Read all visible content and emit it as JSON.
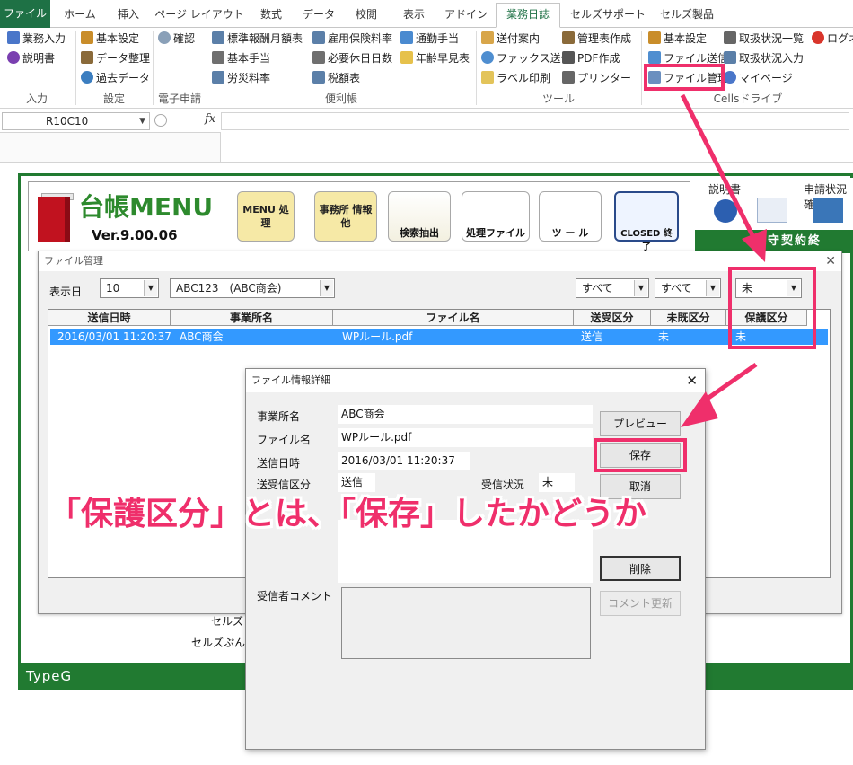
{
  "ribbon": {
    "tabs": [
      "ファイル",
      "ホーム",
      "挿入",
      "ページ レイアウト",
      "数式",
      "データ",
      "校閲",
      "表示",
      "アドイン",
      "業務日誌",
      "セルズサポート",
      "セルズ製品"
    ],
    "active_tab": "業務日誌",
    "groups": {
      "input": {
        "label": "入力",
        "items": [
          "業務入力",
          "説明書"
        ]
      },
      "settings": {
        "label": "設定",
        "items": [
          "基本設定",
          "データ整理",
          "過去データ"
        ]
      },
      "e_apply": {
        "label": "電子申請",
        "items": [
          "確認"
        ]
      },
      "handy": {
        "label": "便利帳",
        "items": [
          "標準報酬月額表",
          "基本手当",
          "労災料率",
          "雇用保険料率",
          "必要休日日数",
          "税額表",
          "通勤手当",
          "年齢早見表"
        ]
      },
      "tools": {
        "label": "ツール",
        "items": [
          "送付案内",
          "ファックス送信",
          "ラベル印刷",
          "管理表作成",
          "PDF作成",
          "プリンター"
        ]
      },
      "cells_drive": {
        "label": "Cellsドライブ",
        "items": [
          "基本設定",
          "ファイル送信",
          "ファイル管理",
          "取扱状況一覧",
          "取扱状況入力",
          "マイページ",
          "ログオフ"
        ]
      }
    }
  },
  "formula_bar": {
    "namebox": "R10C10",
    "fx": "fx"
  },
  "menu": {
    "title": "台帳MENU",
    "version": "Ver.9.00.06",
    "buttons": [
      "MENU 処 理",
      "事務所 情報他",
      "検索抽出",
      "処理ファイル",
      "ツ ー ル",
      "CLOSED 終 了"
    ],
    "right_top": [
      "説明書",
      "申請状況確"
    ],
    "right_banner": "保守契約終",
    "footer": "TypeG",
    "bg_cells": [
      "セルズ",
      "セルズぷん"
    ]
  },
  "file_manager": {
    "title": "ファイル管理",
    "day_label": "表示日",
    "day_value": "10",
    "office_value": "ABC123　(ABC商会)",
    "filters": [
      "すべて",
      "すべて",
      "未"
    ],
    "columns": [
      "送信日時",
      "事業所名",
      "ファイル名",
      "送受区分",
      "未既区分",
      "保護区分"
    ],
    "rows": [
      {
        "sent": "2016/03/01 11:20:37",
        "office": "ABC商会",
        "file": "WPルール.pdf",
        "direction": "送信",
        "read": "未",
        "protect": "未"
      }
    ]
  },
  "detail": {
    "title": "ファイル情報詳細",
    "fields": [
      {
        "label": "事業所名",
        "value": "ABC商会"
      },
      {
        "label": "ファイル名",
        "value": "WPルール.pdf"
      },
      {
        "label": "送信日時",
        "value": "2016/03/01 11:20:37"
      },
      {
        "label": "送受信区分",
        "value": "送信"
      }
    ],
    "recv_status_label": "受信状況",
    "recv_status_value": "未",
    "recv_comment_label": "受信者コメント",
    "buttons": {
      "preview": "プレビュー",
      "save": "保存",
      "cancel": "取消",
      "delete": "削除",
      "update_comment": "コメント更新"
    }
  },
  "annotation": {
    "caption": "「保護区分」とは、「保存」したかどうか",
    "color": "#ef2f6b"
  },
  "colors": {
    "excel_green": "#1e7145",
    "frame_green": "#217a31",
    "selection": "#3399ff",
    "highlight": "#ef2f6b"
  }
}
